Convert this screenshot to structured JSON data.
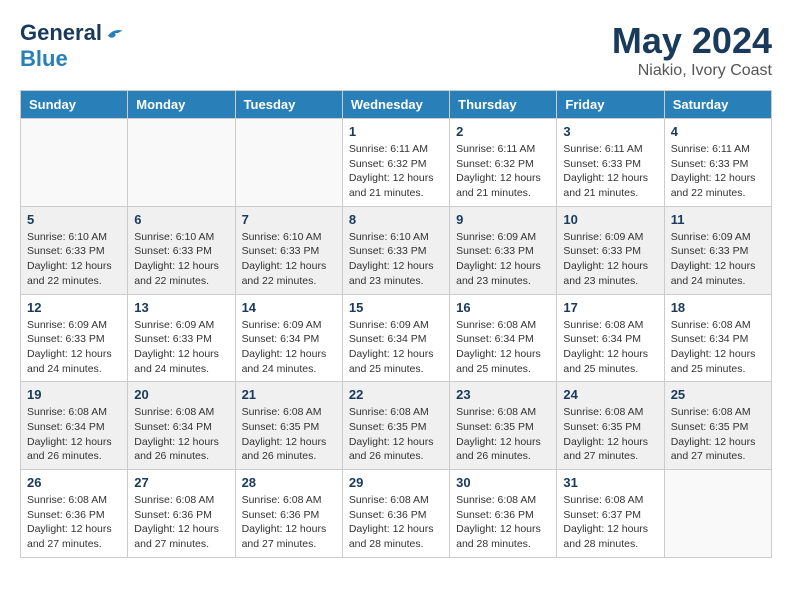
{
  "header": {
    "logo_general": "General",
    "logo_blue": "Blue",
    "month": "May 2024",
    "location": "Niakio, Ivory Coast"
  },
  "days_of_week": [
    "Sunday",
    "Monday",
    "Tuesday",
    "Wednesday",
    "Thursday",
    "Friday",
    "Saturday"
  ],
  "weeks": [
    [
      {
        "day": "",
        "info": "",
        "empty": true
      },
      {
        "day": "",
        "info": "",
        "empty": true
      },
      {
        "day": "",
        "info": "",
        "empty": true
      },
      {
        "day": "1",
        "info": "Sunrise: 6:11 AM\nSunset: 6:32 PM\nDaylight: 12 hours\nand 21 minutes.",
        "empty": false
      },
      {
        "day": "2",
        "info": "Sunrise: 6:11 AM\nSunset: 6:32 PM\nDaylight: 12 hours\nand 21 minutes.",
        "empty": false
      },
      {
        "day": "3",
        "info": "Sunrise: 6:11 AM\nSunset: 6:33 PM\nDaylight: 12 hours\nand 21 minutes.",
        "empty": false
      },
      {
        "day": "4",
        "info": "Sunrise: 6:11 AM\nSunset: 6:33 PM\nDaylight: 12 hours\nand 22 minutes.",
        "empty": false
      }
    ],
    [
      {
        "day": "5",
        "info": "Sunrise: 6:10 AM\nSunset: 6:33 PM\nDaylight: 12 hours\nand 22 minutes.",
        "empty": false
      },
      {
        "day": "6",
        "info": "Sunrise: 6:10 AM\nSunset: 6:33 PM\nDaylight: 12 hours\nand 22 minutes.",
        "empty": false
      },
      {
        "day": "7",
        "info": "Sunrise: 6:10 AM\nSunset: 6:33 PM\nDaylight: 12 hours\nand 22 minutes.",
        "empty": false
      },
      {
        "day": "8",
        "info": "Sunrise: 6:10 AM\nSunset: 6:33 PM\nDaylight: 12 hours\nand 23 minutes.",
        "empty": false
      },
      {
        "day": "9",
        "info": "Sunrise: 6:09 AM\nSunset: 6:33 PM\nDaylight: 12 hours\nand 23 minutes.",
        "empty": false
      },
      {
        "day": "10",
        "info": "Sunrise: 6:09 AM\nSunset: 6:33 PM\nDaylight: 12 hours\nand 23 minutes.",
        "empty": false
      },
      {
        "day": "11",
        "info": "Sunrise: 6:09 AM\nSunset: 6:33 PM\nDaylight: 12 hours\nand 24 minutes.",
        "empty": false
      }
    ],
    [
      {
        "day": "12",
        "info": "Sunrise: 6:09 AM\nSunset: 6:33 PM\nDaylight: 12 hours\nand 24 minutes.",
        "empty": false
      },
      {
        "day": "13",
        "info": "Sunrise: 6:09 AM\nSunset: 6:33 PM\nDaylight: 12 hours\nand 24 minutes.",
        "empty": false
      },
      {
        "day": "14",
        "info": "Sunrise: 6:09 AM\nSunset: 6:34 PM\nDaylight: 12 hours\nand 24 minutes.",
        "empty": false
      },
      {
        "day": "15",
        "info": "Sunrise: 6:09 AM\nSunset: 6:34 PM\nDaylight: 12 hours\nand 25 minutes.",
        "empty": false
      },
      {
        "day": "16",
        "info": "Sunrise: 6:08 AM\nSunset: 6:34 PM\nDaylight: 12 hours\nand 25 minutes.",
        "empty": false
      },
      {
        "day": "17",
        "info": "Sunrise: 6:08 AM\nSunset: 6:34 PM\nDaylight: 12 hours\nand 25 minutes.",
        "empty": false
      },
      {
        "day": "18",
        "info": "Sunrise: 6:08 AM\nSunset: 6:34 PM\nDaylight: 12 hours\nand 25 minutes.",
        "empty": false
      }
    ],
    [
      {
        "day": "19",
        "info": "Sunrise: 6:08 AM\nSunset: 6:34 PM\nDaylight: 12 hours\nand 26 minutes.",
        "empty": false
      },
      {
        "day": "20",
        "info": "Sunrise: 6:08 AM\nSunset: 6:34 PM\nDaylight: 12 hours\nand 26 minutes.",
        "empty": false
      },
      {
        "day": "21",
        "info": "Sunrise: 6:08 AM\nSunset: 6:35 PM\nDaylight: 12 hours\nand 26 minutes.",
        "empty": false
      },
      {
        "day": "22",
        "info": "Sunrise: 6:08 AM\nSunset: 6:35 PM\nDaylight: 12 hours\nand 26 minutes.",
        "empty": false
      },
      {
        "day": "23",
        "info": "Sunrise: 6:08 AM\nSunset: 6:35 PM\nDaylight: 12 hours\nand 26 minutes.",
        "empty": false
      },
      {
        "day": "24",
        "info": "Sunrise: 6:08 AM\nSunset: 6:35 PM\nDaylight: 12 hours\nand 27 minutes.",
        "empty": false
      },
      {
        "day": "25",
        "info": "Sunrise: 6:08 AM\nSunset: 6:35 PM\nDaylight: 12 hours\nand 27 minutes.",
        "empty": false
      }
    ],
    [
      {
        "day": "26",
        "info": "Sunrise: 6:08 AM\nSunset: 6:36 PM\nDaylight: 12 hours\nand 27 minutes.",
        "empty": false
      },
      {
        "day": "27",
        "info": "Sunrise: 6:08 AM\nSunset: 6:36 PM\nDaylight: 12 hours\nand 27 minutes.",
        "empty": false
      },
      {
        "day": "28",
        "info": "Sunrise: 6:08 AM\nSunset: 6:36 PM\nDaylight: 12 hours\nand 27 minutes.",
        "empty": false
      },
      {
        "day": "29",
        "info": "Sunrise: 6:08 AM\nSunset: 6:36 PM\nDaylight: 12 hours\nand 28 minutes.",
        "empty": false
      },
      {
        "day": "30",
        "info": "Sunrise: 6:08 AM\nSunset: 6:36 PM\nDaylight: 12 hours\nand 28 minutes.",
        "empty": false
      },
      {
        "day": "31",
        "info": "Sunrise: 6:08 AM\nSunset: 6:37 PM\nDaylight: 12 hours\nand 28 minutes.",
        "empty": false
      },
      {
        "day": "",
        "info": "",
        "empty": true
      }
    ]
  ]
}
